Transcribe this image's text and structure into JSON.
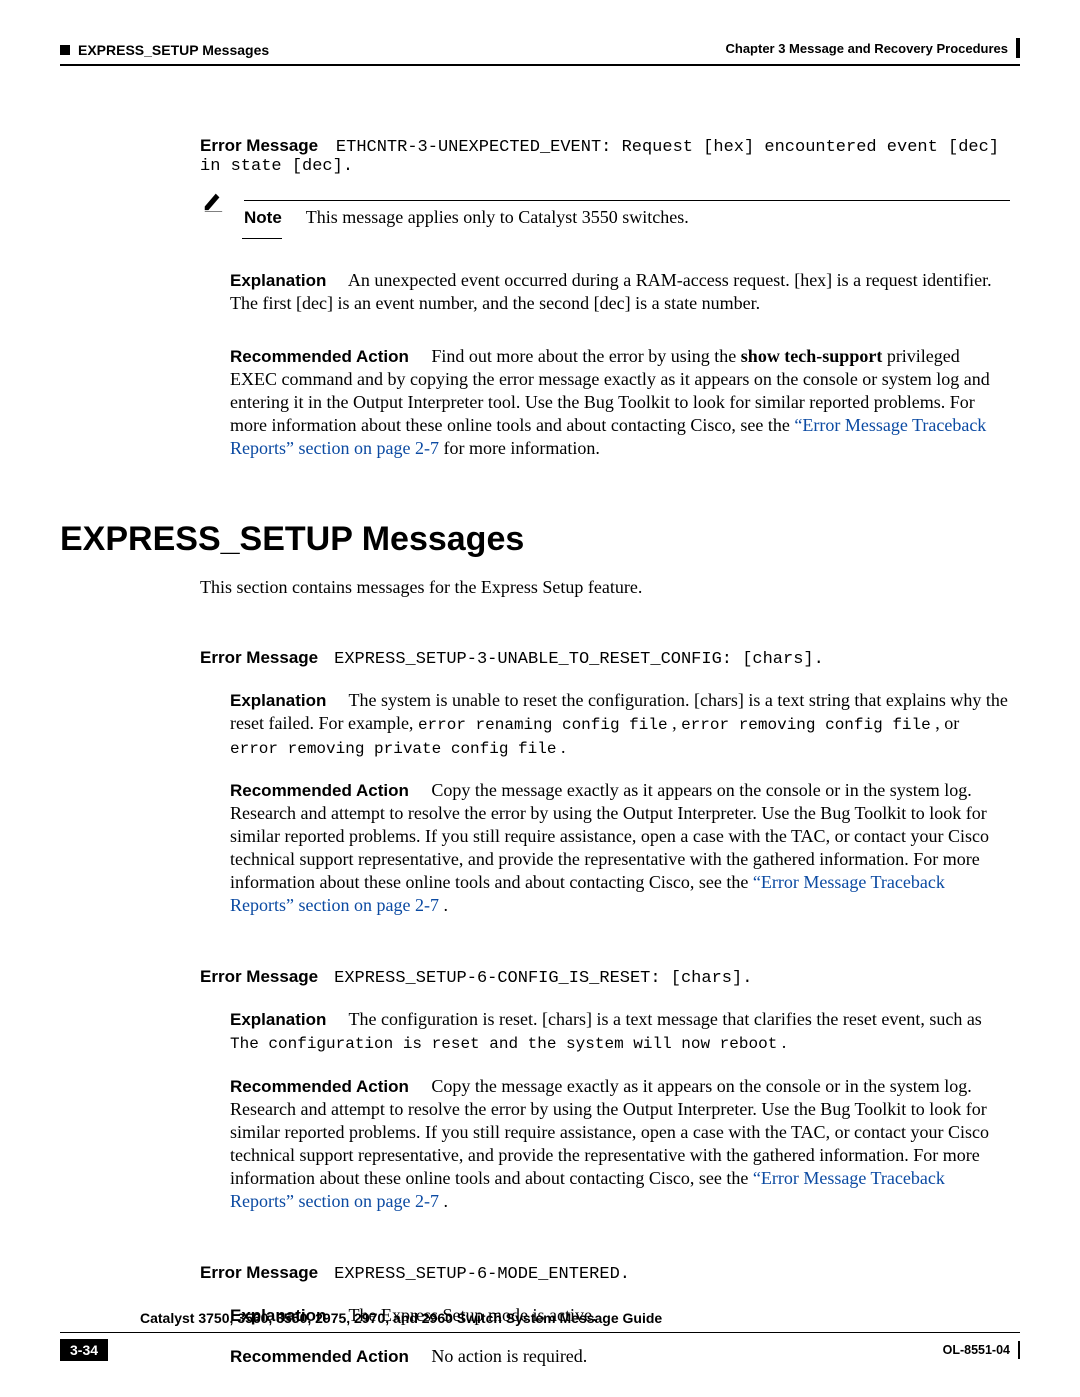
{
  "header": {
    "section": "EXPRESS_SETUP Messages",
    "chapter": "Chapter 3      Message and Recovery Procedures"
  },
  "msg1": {
    "label": "Error Message",
    "code": "ETHCNTR-3-UNEXPECTED_EVENT: Request [hex] encountered event [dec] in state [dec].",
    "noteLabel": "Note",
    "noteText": "This message applies only to Catalyst 3550 switches.",
    "explLabel": "Explanation",
    "expl": "An unexpected event occurred during a RAM-access request. [hex] is a request identifier. The first [dec] is an event number, and the second [dec] is a state number.",
    "actLabel": "Recommended Action",
    "act1": "Find out more about the error by using the ",
    "actBold": "show tech-support",
    "act2": " privileged EXEC command and by copying the error message exactly as it appears on the console or system log and entering it in the Output Interpreter tool. Use the Bug Toolkit to look for similar reported problems. For more information about these online tools and about contacting Cisco, see the ",
    "link": "“Error Message Traceback Reports” section on page 2-7",
    "act3": " for more information."
  },
  "sectionTitle": "EXPRESS_SETUP Messages",
  "sectionIntro": "This section contains messages for the Express Setup feature.",
  "msg2": {
    "label": "Error Message",
    "code": "EXPRESS_SETUP-3-UNABLE_TO_RESET_CONFIG: [chars].",
    "explLabel": "Explanation",
    "expl1": "The system is unable to reset the configuration. [chars] is a text string that explains why the reset failed. For example, ",
    "mono1": "error renaming config file",
    "expl2": ", ",
    "mono2": "error removing config file",
    "expl3": ", or ",
    "mono3": "error removing private config file",
    "expl4": ".",
    "actLabel": "Recommended Action",
    "act": "Copy the message exactly as it appears on the console or in the system log. Research and attempt to resolve the error by using the Output Interpreter. Use the Bug Toolkit to look for similar reported problems. If you still require assistance, open a case with the TAC, or contact your Cisco technical support representative, and provide the representative with the gathered information. For more information about these online tools and about contacting Cisco, see the ",
    "link": "“Error Message Traceback Reports” section on page 2-7",
    "actEnd": "."
  },
  "msg3": {
    "label": "Error Message",
    "code": "EXPRESS_SETUP-6-CONFIG_IS_RESET: [chars].",
    "explLabel": "Explanation",
    "expl1": "The configuration is reset. [chars] is a text message that clarifies the reset event, such as ",
    "mono1": "The configuration is reset and the system will now reboot",
    "expl2": ".",
    "actLabel": "Recommended Action",
    "act": "Copy the message exactly as it appears on the console or in the system log. Research and attempt to resolve the error by using the Output Interpreter. Use the Bug Toolkit to look for similar reported problems. If you still require assistance, open a case with the TAC, or contact your Cisco technical support representative, and provide the representative with the gathered information. For more information about these online tools and about contacting Cisco, see the ",
    "link": "“Error Message Traceback Reports” section on page 2-7",
    "actEnd": "."
  },
  "msg4": {
    "label": "Error Message",
    "code": "EXPRESS_SETUP-6-MODE_ENTERED.",
    "explLabel": "Explanation",
    "expl": "The Express Setup mode is active.",
    "actLabel": "Recommended Action",
    "act": "No action is required."
  },
  "footer": {
    "guide": "Catalyst 3750, 3560, 3550, 2975, 2970, and 2960 Switch System Message Guide",
    "page": "3-34",
    "doc": "OL-8551-04"
  }
}
